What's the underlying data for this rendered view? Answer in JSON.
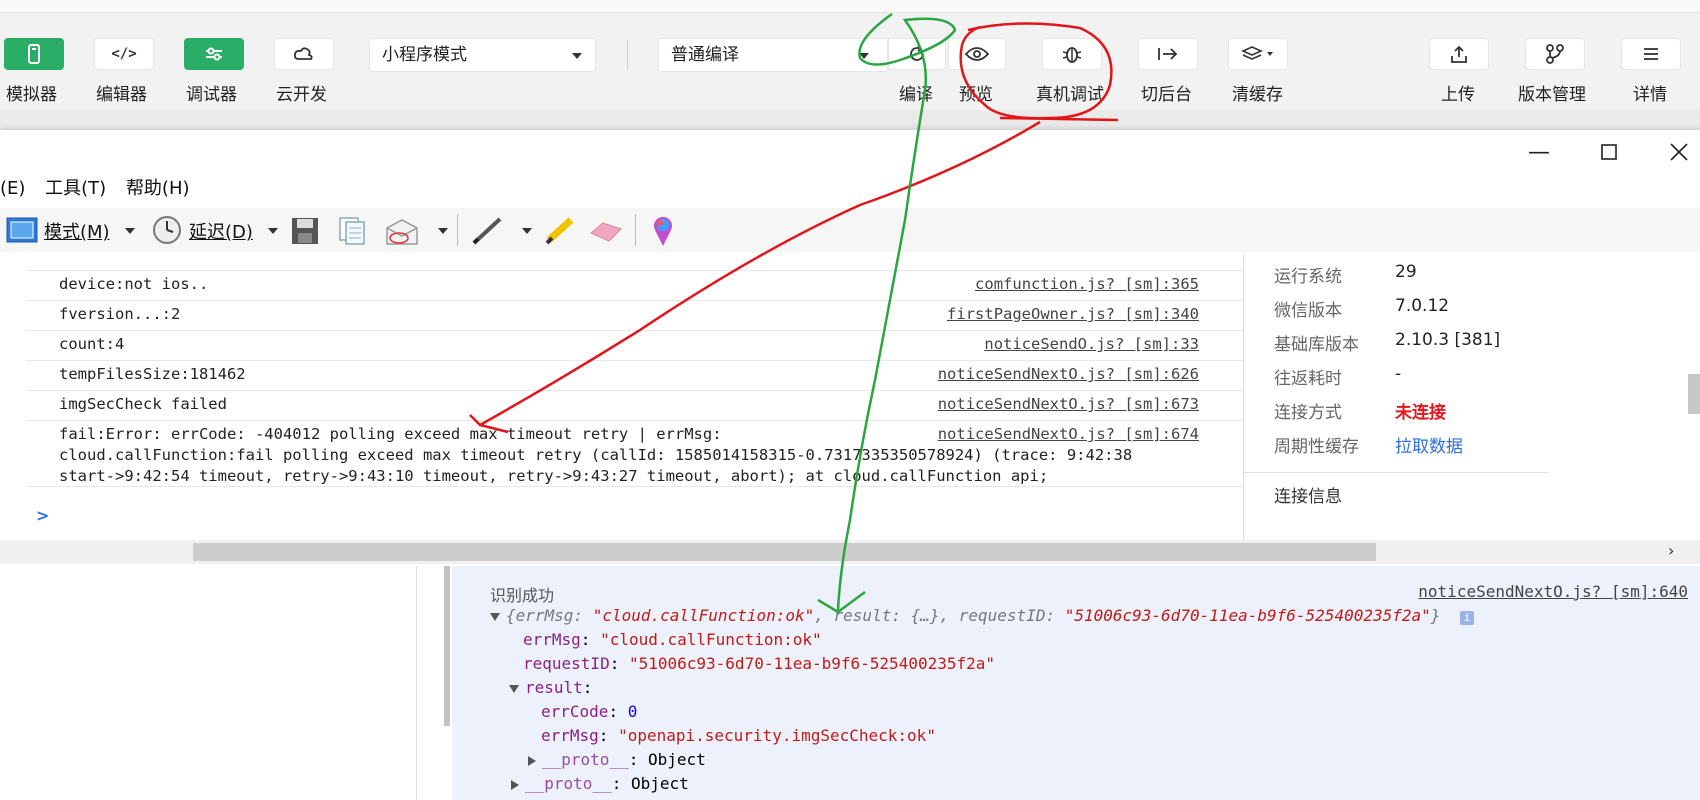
{
  "toolbar": {
    "buttons": [
      {
        "label": "模拟器"
      },
      {
        "label": "编辑器"
      },
      {
        "label": "调试器"
      },
      {
        "label": "云开发"
      }
    ],
    "mode_select": "小程序模式",
    "compile_select": "普通编译",
    "actions": [
      {
        "label": "编译"
      },
      {
        "label": "预览"
      },
      {
        "label": "真机调试"
      },
      {
        "label": "切后台"
      },
      {
        "label": "清缓存"
      }
    ],
    "right_actions": [
      {
        "label": "上传"
      },
      {
        "label": "版本管理"
      },
      {
        "label": "详情"
      }
    ]
  },
  "window": {
    "menu": [
      "(E)",
      "工具(T)",
      "帮助(H)"
    ],
    "mode_button": "模式(M)",
    "delay_button": "延迟(D)"
  },
  "log": {
    "rows": [
      {
        "msg": "device:not ios..",
        "src": "comfunction.js? [sm]:365"
      },
      {
        "msg": "fversion...:2",
        "src": "firstPageOwner.js? [sm]:340"
      },
      {
        "msg": "count:4",
        "src": "noticeSendO.js? [sm]:33"
      },
      {
        "msg": "tempFilesSize:181462",
        "src": "noticeSendNextO.js? [sm]:626"
      },
      {
        "msg": "imgSecCheck failed",
        "src": "noticeSendNextO.js? [sm]:673"
      }
    ],
    "error": {
      "line1": "fail:Error: errCode: -404012 polling exceed max timeout retry | errMsg:",
      "line2": "cloud.callFunction:fail polling exceed max timeout retry (callId: 1585014158315-0.7317335350578924) (trace: 9:42:38",
      "line3": "start->9:42:54 timeout, retry->9:43:10 timeout, retry->9:43:27 timeout, abort); at cloud.callFunction api;",
      "src": "noticeSendNextO.js? [sm]:674"
    },
    "prompt": ">"
  },
  "info": {
    "rows": [
      {
        "label": "运行系统",
        "value": "29"
      },
      {
        "label": "微信版本",
        "value": "7.0.12"
      },
      {
        "label": "基础库版本",
        "value": "2.10.3 [381]"
      },
      {
        "label": "往返耗时",
        "value": "-"
      },
      {
        "label": "连接方式",
        "value": "未连接"
      },
      {
        "label": "周期性缓存",
        "value": "拉取数据"
      }
    ],
    "section_title": "连接信息",
    "colors": {
      "disconnected": "#e5161b",
      "link": "#2c6fe0"
    }
  },
  "console": {
    "success_text": "识别成功",
    "success_src": "noticeSendNextO.js? [sm]:640",
    "obj_summary_open": "{errMsg: ",
    "obj_summary_errmsg": "\"cloud.callFunction:ok\"",
    "obj_summary_mid": ", result: {…}, requestID: ",
    "obj_summary_reqid": "\"51006c93-6d70-11ea-b9f6-525400235f2a\"",
    "obj_summary_close": "}",
    "errMsg_key": "errMsg",
    "errMsg_val": "\"cloud.callFunction:ok\"",
    "requestID_key": "requestID",
    "requestID_val": "\"51006c93-6d70-11ea-b9f6-525400235f2a\"",
    "result_key": "result",
    "errCode_key": "errCode",
    "errCode_val": "0",
    "inner_errMsg_key": "errMsg",
    "inner_errMsg_val": "\"openapi.security.imgSecCheck:ok\"",
    "proto_key": "__proto__",
    "proto_val": "Object"
  }
}
